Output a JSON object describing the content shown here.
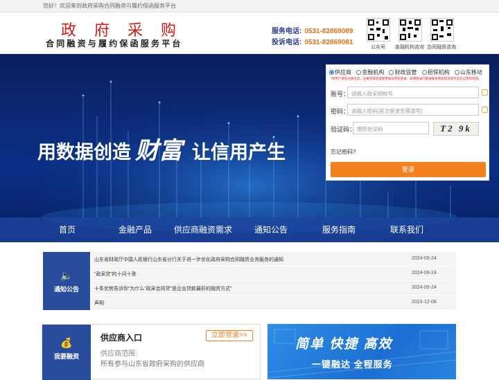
{
  "topbar": {
    "welcome": "您好！欢迎来到政府采购合同融资与履约保函服务平台"
  },
  "header": {
    "title": "政府采购",
    "subtitle": "合同融资与履约保函服务平台",
    "service_label": "服务电话:",
    "service_phone": "0531-82869089",
    "complaint_label": "投诉电话:",
    "complaint_phone": "0531-82869081",
    "qr_codes": [
      {
        "caption": "公众号"
      },
      {
        "caption": "金融机构咨询"
      },
      {
        "caption": "合同融资咨询"
      }
    ]
  },
  "banner": {
    "slogan_a": "用数据创造",
    "slogan_b": "财富",
    "slogan_c": "让信用产生"
  },
  "nav": {
    "items": [
      "首页",
      "金融产品",
      "供应商融资需求",
      "通知公告",
      "服务指南",
      "联系我们"
    ]
  },
  "login": {
    "roles": [
      "供应商",
      "金融机构",
      "财政监管",
      "担保机构",
      "山东移动"
    ],
    "selected_role": "供应商",
    "notice": "*新用户请先注册信息，注册完成后请使用账号密码登录；如遇登录问题请联系客服电话或点击忘记密码找回。",
    "account_label": "账号：",
    "account_placeholder": "请输入政采网账号",
    "password_label": "密码：",
    "password_placeholder": "请输入密码(首次登录无需填写)",
    "captcha_label": "验证码：",
    "captcha_placeholder": "图形验证码",
    "captcha_text": "T2 9k",
    "forgot": "忘记密码?",
    "submit": "登录"
  },
  "notices": {
    "title": "通知公告",
    "items": [
      {
        "title": "山东省财政厅中国人民银行山东省分行关于进一步优化政府采购合同融资业务服务的通知",
        "date": "2024-09-24"
      },
      {
        "title": "“政采贷”的十问十答",
        "date": "2024-09-24"
      },
      {
        "title": "十条优势告诉你“为什么“政采合同贷”是企业贷款最好的融资方式”",
        "date": "2024-09-24"
      },
      {
        "title": "声明",
        "date": "2023-12-08"
      }
    ]
  },
  "financing": {
    "title": "我要融资",
    "entry_title": "供应商入口",
    "login_button": "立即登录>>",
    "scope_label": "供应商范围:",
    "scope_desc": "所有参与山东省政府采购的供应商"
  },
  "promo": {
    "line1": "简单  快捷  高效",
    "line2": "一键融达  全程服务"
  }
}
